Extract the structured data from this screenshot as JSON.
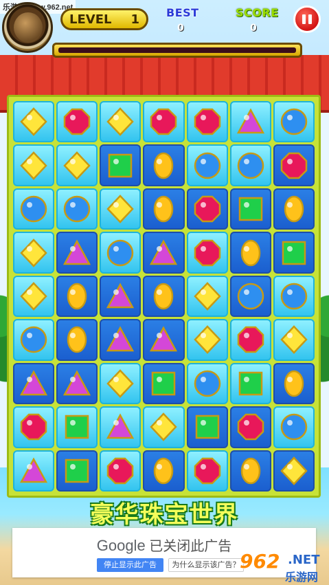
{
  "watermark_top": "乐游网 www.962.net",
  "hud": {
    "level_label": "LEVEL",
    "level_value": "1",
    "best_label": "BEST",
    "best_value": "0",
    "score_label": "SCORE",
    "score_value": "0",
    "progress_fraction": 0.0
  },
  "board": {
    "rows": [
      [
        "yellow",
        "red",
        "yellow",
        "red",
        "red",
        "purple",
        "blue"
      ],
      [
        "yellow",
        "yellow",
        "green",
        "orange",
        "blue",
        "blue",
        "red"
      ],
      [
        "blue",
        "blue",
        "yellow",
        "orange",
        "red",
        "green",
        "orange"
      ],
      [
        "yellow",
        "purple",
        "blue",
        "purple",
        "red",
        "orange",
        "green"
      ],
      [
        "yellow",
        "orange",
        "purple",
        "orange",
        "yellow",
        "blue",
        "blue"
      ],
      [
        "blue",
        "orange",
        "purple",
        "purple",
        "yellow",
        "red",
        "yellow"
      ],
      [
        "purple",
        "purple",
        "yellow",
        "green",
        "blue",
        "green",
        "orange"
      ],
      [
        "red",
        "green",
        "purple",
        "yellow",
        "green",
        "red",
        "blue"
      ],
      [
        "purple",
        "green",
        "red",
        "orange",
        "red",
        "orange",
        "yellow"
      ]
    ],
    "tile_shades": [
      [
        "light",
        "light",
        "light",
        "light",
        "light",
        "light",
        "light"
      ],
      [
        "light",
        "light",
        "dark",
        "dark",
        "light",
        "light",
        "dark"
      ],
      [
        "light",
        "light",
        "light",
        "dark",
        "dark",
        "dark",
        "dark"
      ],
      [
        "light",
        "dark",
        "light",
        "dark",
        "light",
        "dark",
        "dark"
      ],
      [
        "light",
        "dark",
        "dark",
        "dark",
        "light",
        "dark",
        "light"
      ],
      [
        "light",
        "dark",
        "dark",
        "dark",
        "light",
        "light",
        "light"
      ],
      [
        "dark",
        "dark",
        "light",
        "dark",
        "light",
        "light",
        "dark"
      ],
      [
        "light",
        "light",
        "light",
        "light",
        "dark",
        "dark",
        "light"
      ],
      [
        "light",
        "dark",
        "light",
        "dark",
        "light",
        "dark",
        "dark"
      ]
    ]
  },
  "colors": {
    "yellow": "#ffe53b",
    "red": "#e8185a",
    "green": "#1fcf4a",
    "orange": "#ffc21a",
    "blue": "#2e8ff0",
    "purple": "#d447d8"
  },
  "footer_title": "豪华珠宝世界",
  "ad": {
    "brand": "Google",
    "message": "已关闭此广告",
    "stop_button": "停止显示此广告",
    "why_button": "为什么显示该广告？"
  },
  "watermark_bottom": {
    "number": "962",
    "domain": ".NET",
    "label": "乐游网"
  }
}
